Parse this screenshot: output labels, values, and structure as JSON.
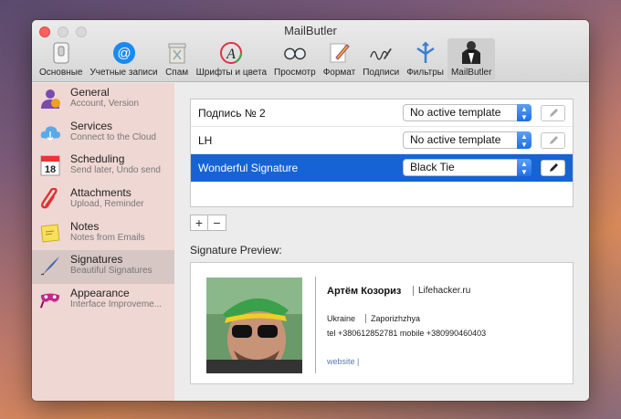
{
  "window": {
    "title": "MailButler"
  },
  "toolbar": {
    "items": [
      {
        "label": "Основные",
        "icon": "general-switch-icon"
      },
      {
        "label": "Учетные записи",
        "icon": "at-sign-icon"
      },
      {
        "label": "Спам",
        "icon": "spam-trash-icon"
      },
      {
        "label": "Шрифты и цвета",
        "icon": "fonts-colors-icon"
      },
      {
        "label": "Просмотр",
        "icon": "glasses-icon"
      },
      {
        "label": "Формат",
        "icon": "pencil-paper-icon"
      },
      {
        "label": "Подписи",
        "icon": "signature-pen-icon"
      },
      {
        "label": "Фильтры",
        "icon": "filter-icon"
      },
      {
        "label": "MailButler",
        "icon": "butler-icon",
        "active": true
      }
    ]
  },
  "sidebar": {
    "items": [
      {
        "title": "General",
        "subtitle": "Account, Version",
        "icon": "user-icon"
      },
      {
        "title": "Services",
        "subtitle": "Connect to the Cloud",
        "icon": "cloud-icon"
      },
      {
        "title": "Scheduling",
        "subtitle": "Send later, Undo send",
        "icon": "calendar-icon",
        "day": "18"
      },
      {
        "title": "Attachments",
        "subtitle": "Upload, Reminder",
        "icon": "paperclip-icon"
      },
      {
        "title": "Notes",
        "subtitle": "Notes from Emails",
        "icon": "sticky-note-icon"
      },
      {
        "title": "Signatures",
        "subtitle": "Beautiful Signatures",
        "icon": "quill-pen-icon",
        "selected": true
      },
      {
        "title": "Appearance",
        "subtitle": "Interface Improveme...",
        "icon": "mask-icon"
      }
    ]
  },
  "signatures": {
    "rows": [
      {
        "name": "Подпись № 2",
        "template": "No active template"
      },
      {
        "name": "LH",
        "template": "No active template"
      },
      {
        "name": "Wonderful Signature",
        "template": "Black Tie",
        "selected": true
      }
    ],
    "add_label": "+",
    "remove_label": "−"
  },
  "preview": {
    "label": "Signature Preview:",
    "name": "Артём Козориз",
    "site": "Lifehacker.ru",
    "country": "Ukraine",
    "city": "Zaporizhzhya",
    "phones": "tel +380612852781   mobile +380990460403",
    "website": "website |"
  },
  "colors": {
    "selection": "#1663d6",
    "sidebar": "#efd7d3",
    "close": "#fc605c"
  }
}
